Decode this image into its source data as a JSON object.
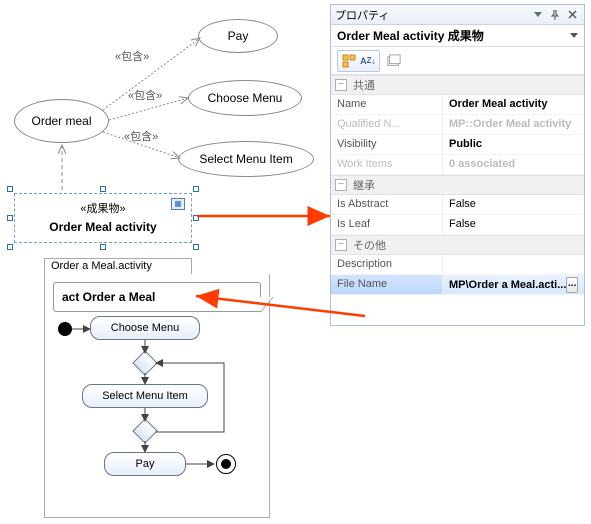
{
  "uml": {
    "usecases": {
      "order_meal": "Order meal",
      "pay": "Pay",
      "choose_menu": "Choose Menu",
      "select_menu_item": "Select Menu Item"
    },
    "include_stereotype": "«包含»",
    "artifact": {
      "stereotype": "«成果物»",
      "name": "Order Meal activity"
    }
  },
  "activity": {
    "tab_label": "Order a Meal.activity",
    "frame_label": "act Order a Meal",
    "nodes": {
      "choose": "Choose Menu",
      "select": "Select Menu Item",
      "pay": "Pay"
    }
  },
  "properties": {
    "panel_title": "プロパティ",
    "subject": "Order Meal activity 成果物",
    "categories": {
      "common": "共通",
      "inheritance": "継承",
      "other": "その他"
    },
    "rows": {
      "name": {
        "label": "Name",
        "value": "Order Meal activity"
      },
      "qualified": {
        "label": "Qualified N...",
        "value": "MP::Order Meal activity"
      },
      "visibility": {
        "label": "Visibility",
        "value": "Public"
      },
      "workitems": {
        "label": "Work Items",
        "value": "0 associated"
      },
      "is_abstract": {
        "label": "Is Abstract",
        "value": "False"
      },
      "is_leaf": {
        "label": "Is Leaf",
        "value": "False"
      },
      "description": {
        "label": "Description",
        "value": ""
      },
      "filename": {
        "label": "File Name",
        "value": "MP\\Order a Meal.acti..."
      }
    },
    "ellipsis_label": "..."
  }
}
